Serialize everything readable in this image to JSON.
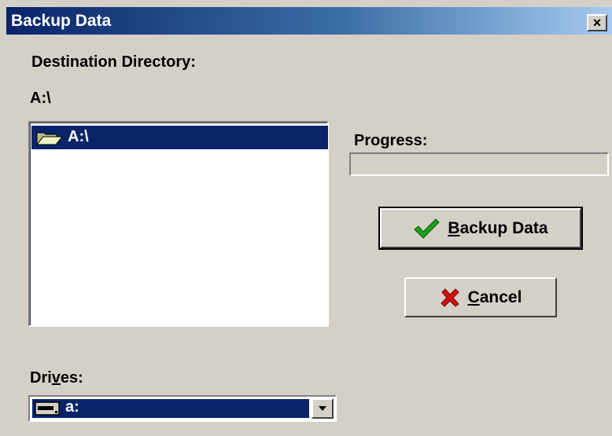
{
  "window": {
    "title": "Backup Data",
    "close_label": "×"
  },
  "destination": {
    "label": "Destination Directory:",
    "path": "A:\\"
  },
  "directory_list": {
    "items": [
      {
        "label": "A:\\",
        "icon": "open-folder-icon",
        "selected": true
      }
    ]
  },
  "progress": {
    "label": "Progress:",
    "percent": 0
  },
  "buttons": {
    "backup": {
      "prefix": "",
      "accel": "B",
      "rest": "ackup Data",
      "icon": "checkmark-icon"
    },
    "cancel": {
      "prefix": "",
      "accel": "C",
      "rest": "ancel",
      "icon": "x-cross-icon"
    }
  },
  "drives": {
    "label_prefix": "Dri",
    "label_accel": "v",
    "label_rest": "es:",
    "selected": "a:",
    "icon": "floppy-drive-icon"
  },
  "colors": {
    "face": "#d4d0c8",
    "selection": "#0a246a",
    "check_green": "#1e9e1e",
    "cross_red": "#d01010"
  }
}
